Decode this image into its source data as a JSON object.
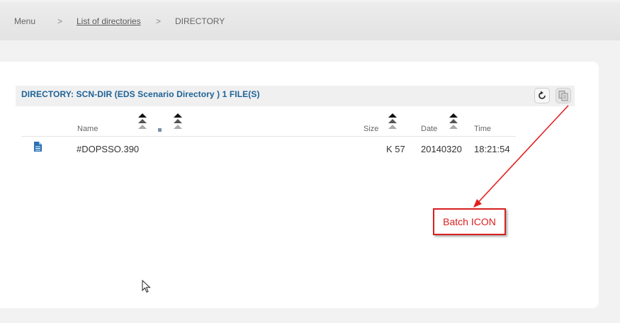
{
  "breadcrumb": {
    "menu": "Menu",
    "separator": ">",
    "list_of_directories": "List of directories",
    "current": "DIRECTORY"
  },
  "directory": {
    "title": "DIRECTORY: SCN-DIR (EDS Scenario Directory ) 1 FILE(S)",
    "buttons": {
      "refresh_icon": "refresh-icon",
      "batch_icon": "batch-copy-icon"
    }
  },
  "table": {
    "columns": {
      "name": "Name",
      "size": "Size",
      "date": "Date",
      "time": "Time"
    },
    "rows": [
      {
        "icon": "file-icon",
        "name": "#DOPSSO.390",
        "size": "K 57",
        "date": "20140320",
        "time": "18:21:54"
      }
    ]
  },
  "annotation": {
    "label": "Batch ICON",
    "color": "#d92020"
  },
  "colors": {
    "title_blue": "#1d6296",
    "accent_red": "#d92020"
  }
}
